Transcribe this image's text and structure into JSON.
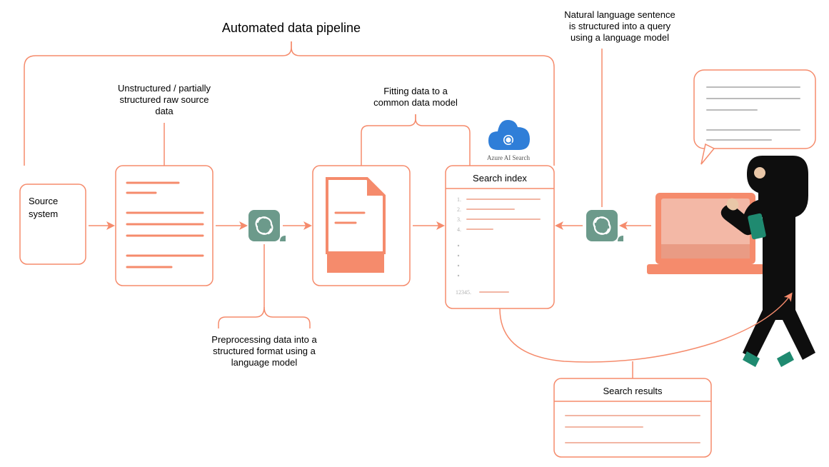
{
  "title": "Automated data pipeline",
  "sourceSystem": {
    "l1": "Source",
    "l2": "system"
  },
  "rawData": {
    "l1": "Unstructured / partially",
    "l2": "structured raw source",
    "l3": "data"
  },
  "preprocess": {
    "l1": "Preprocessing data into a",
    "l2": "structured format using a",
    "l3": "language model"
  },
  "fitting": {
    "l1": "Fitting data to a",
    "l2": "common data model"
  },
  "searchIndex": {
    "title": "Search index",
    "n1": "1.",
    "n2": "2.",
    "n3": "3.",
    "n4": "4.",
    "n5": "12345."
  },
  "azure": "Azure AI Search",
  "nlQuery": {
    "l1": "Natural language sentence",
    "l2": "is structured into a query",
    "l3": "using a language model"
  },
  "results": "Search results"
}
